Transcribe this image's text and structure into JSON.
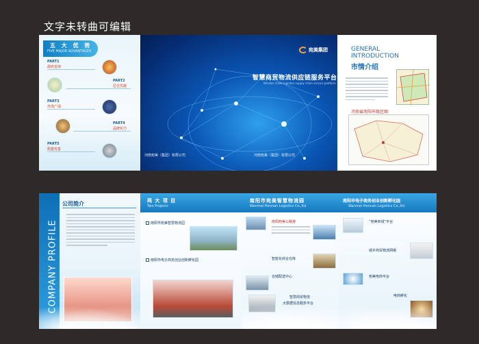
{
  "caption": "文字未转曲可编辑",
  "advantages": {
    "title": "五 大 优 势",
    "subtitle": "FIVE MAJOR ADVANTAGES",
    "parts": [
      {
        "part": "PART1",
        "name": "政府支持"
      },
      {
        "part": "PART2",
        "name": "区位优越"
      },
      {
        "part": "PART3",
        "name": "市场广阔"
      },
      {
        "part": "PART4",
        "name": "品牌实力"
      },
      {
        "part": "PART5",
        "name": "配套完善"
      }
    ]
  },
  "cover": {
    "logo": "宛美集团",
    "title": "智慧商贸物流供应链服务平台",
    "subtitle": "Wisdom trade logistics supply chain service platform",
    "company_left": "河南宛美（集团）有限公司",
    "company_right": "河南宛美（集团）有限公司"
  },
  "intro": {
    "title_en_1": "GENERAL",
    "title_en_2": "INTRODUCTION",
    "title_cn": "市情介绍",
    "map_title": "河南省南阳市政区图"
  },
  "profile": {
    "vertical_title": "COMPANY PROFILE",
    "heading": "公司简介"
  },
  "projects": {
    "title": "两 大 项 目",
    "subtitle": "Two Projects",
    "items": [
      "南阳市宛美智慧物流园",
      "南阳市电子商务创业创新孵化园"
    ]
  },
  "logistics": {
    "title": "南阳市宛美智慧物流园",
    "subtitle": "Wanmei Hennan Logistics Co.,ltd",
    "items": [
      "南阳宛美公路港",
      "智能化综合仓库",
      "仓储配送中心",
      "智慧商贸物流",
      "大数据信息服务平台"
    ]
  },
  "incubator": {
    "title": "南阳市电子商务创业创新孵化园",
    "subtitle": "Wanmei Hennan Logistics Co.,ltd",
    "items": [
      "“宛美商城”平台",
      "城乡商贸物流网络",
      "宛美电商平台",
      "电商孵化"
    ]
  }
}
